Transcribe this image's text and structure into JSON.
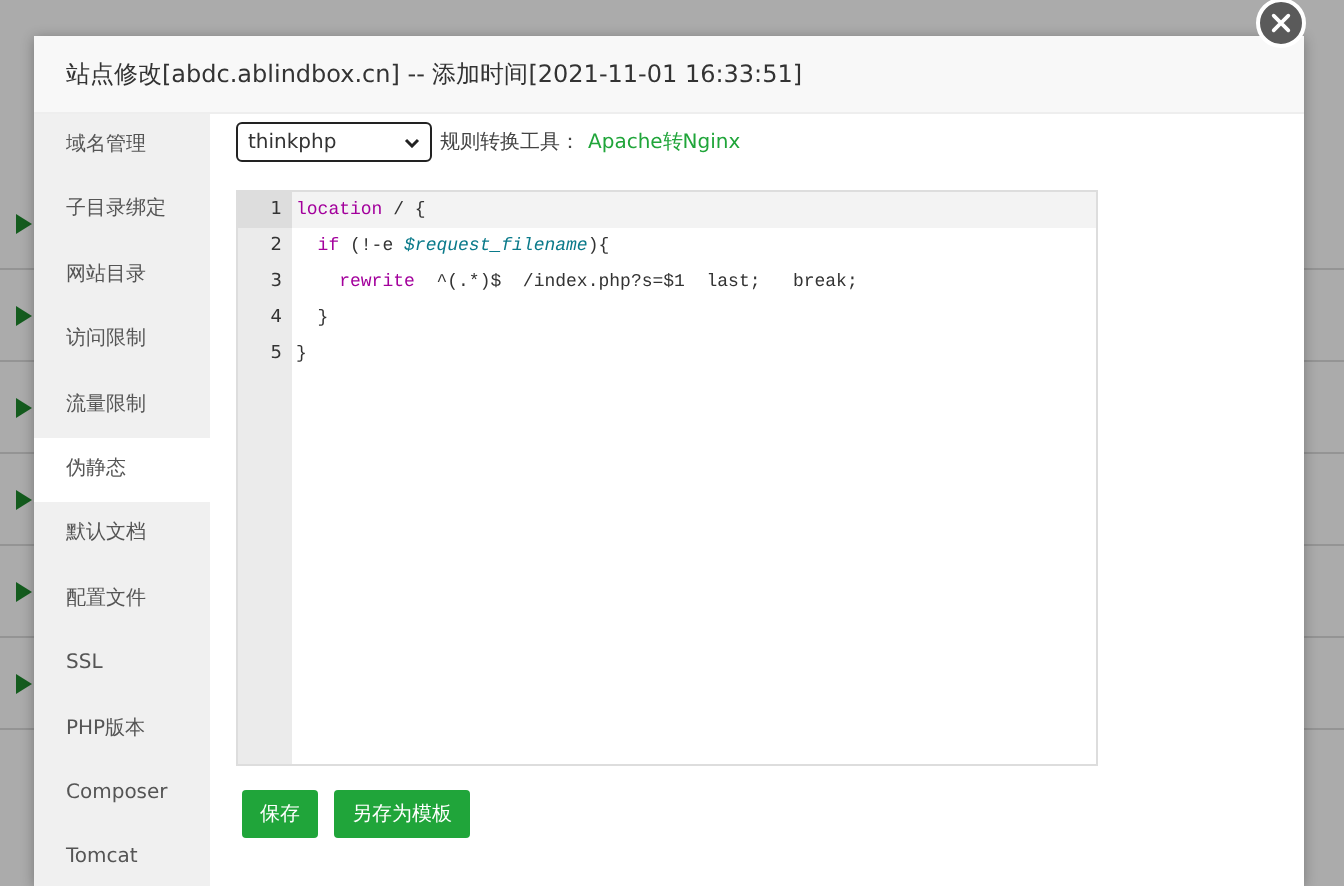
{
  "background": {
    "rows": [
      {
        "kind": "play"
      },
      {
        "kind": "play"
      },
      {
        "kind": "play"
      },
      {
        "kind": "play"
      },
      {
        "kind": "play"
      },
      {
        "kind": "play"
      }
    ]
  },
  "dialog": {
    "title": "站点修改[abdc.ablindbox.cn] -- 添加时间[2021-11-01 16:33:51]",
    "sidebar": {
      "items": [
        {
          "label": "域名管理",
          "selected": false
        },
        {
          "label": "子目录绑定",
          "selected": false
        },
        {
          "label": "网站目录",
          "selected": false
        },
        {
          "label": "访问限制",
          "selected": false
        },
        {
          "label": "流量限制",
          "selected": false
        },
        {
          "label": "伪静态",
          "selected": true
        },
        {
          "label": "默认文档",
          "selected": false
        },
        {
          "label": "配置文件",
          "selected": false
        },
        {
          "label": "SSL",
          "selected": false
        },
        {
          "label": "PHP版本",
          "selected": false
        },
        {
          "label": "Composer",
          "selected": false
        },
        {
          "label": "Tomcat",
          "selected": false
        }
      ]
    },
    "rule_select": {
      "value": "thinkphp"
    },
    "tool_label": "规则转换工具：",
    "tool_link": "Apache转Nginx",
    "editor": {
      "lines": [
        {
          "number": "1",
          "tokens": [
            {
              "kind": "keyword",
              "text": "location"
            },
            {
              "kind": "plain",
              "text": " / {"
            }
          ]
        },
        {
          "number": "2",
          "tokens": [
            {
              "kind": "keyword",
              "text": "  if"
            },
            {
              "kind": "plain",
              "text": " (!-e "
            },
            {
              "kind": "variable",
              "text": "$request_filename"
            },
            {
              "kind": "plain",
              "text": "){"
            }
          ]
        },
        {
          "number": "3",
          "tokens": [
            {
              "kind": "keyword",
              "text": "    rewrite"
            },
            {
              "kind": "plain",
              "text": "  ^(.*)$  /index.php?s=$1  last;   break;"
            }
          ]
        },
        {
          "number": "4",
          "tokens": [
            {
              "kind": "plain",
              "text": "  }"
            }
          ]
        },
        {
          "number": "5",
          "tokens": [
            {
              "kind": "plain",
              "text": "}"
            }
          ]
        }
      ]
    },
    "buttons": [
      "保存",
      "另存为模板"
    ]
  }
}
